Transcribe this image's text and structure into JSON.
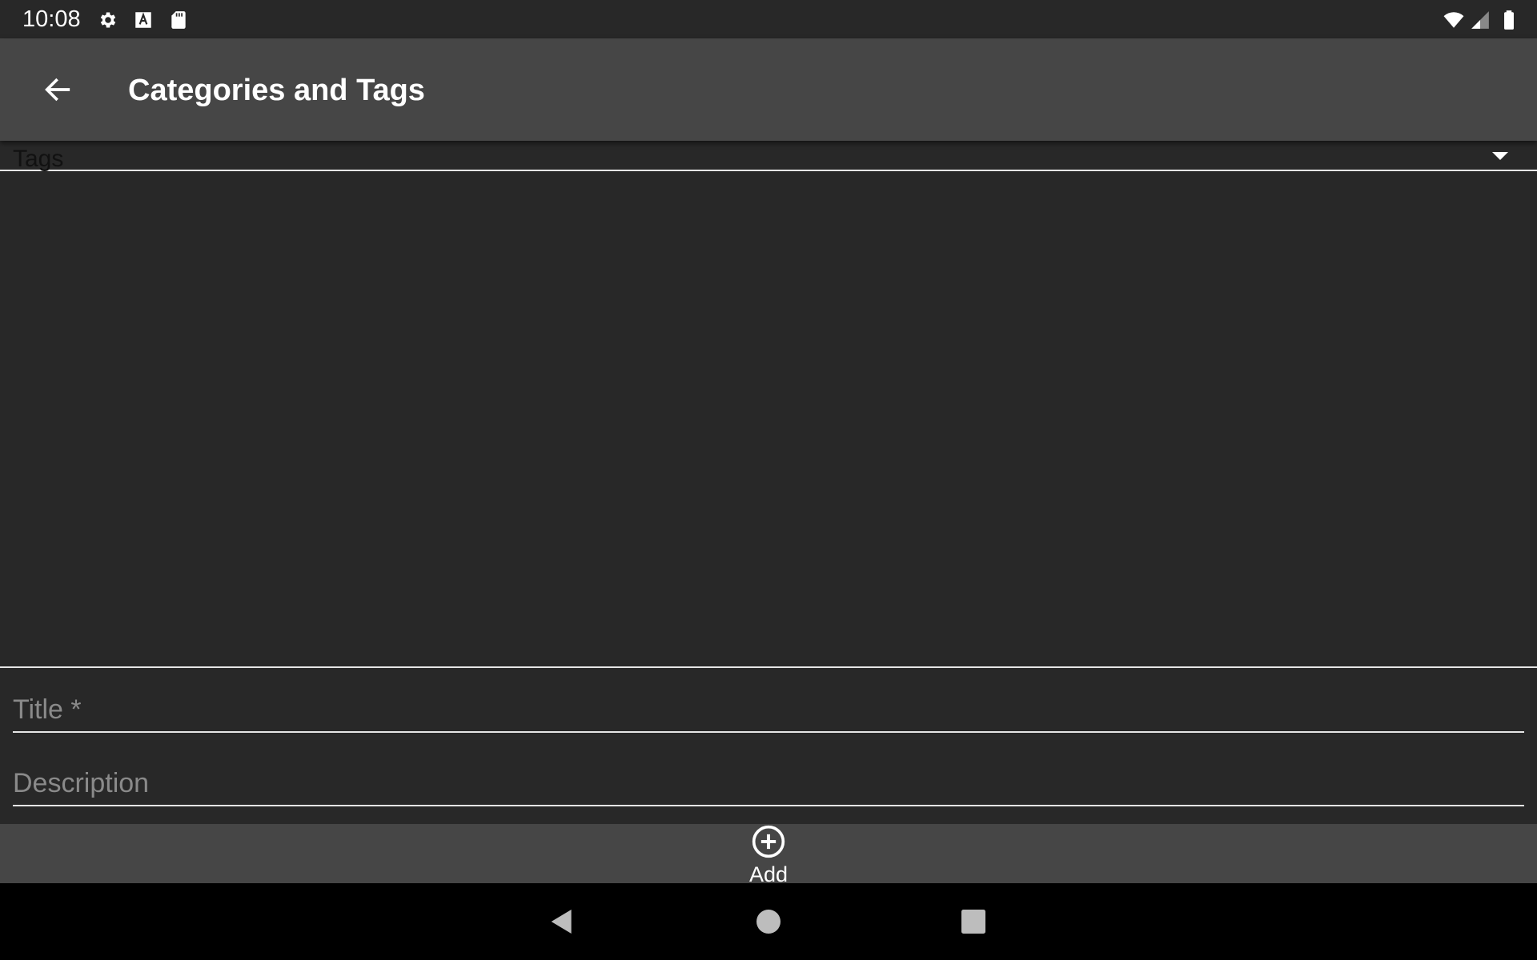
{
  "status_bar": {
    "time": "10:08",
    "icons": [
      "gear-icon",
      "font-a-icon",
      "sd-card-icon",
      "wifi-icon",
      "signal-icon",
      "battery-icon"
    ]
  },
  "app_bar": {
    "title": "Categories and Tags",
    "back_icon": "arrow-back-icon"
  },
  "tags_dropdown": {
    "selected": "Tags"
  },
  "form": {
    "title_placeholder": "Title *",
    "title_value": "",
    "description_placeholder": "Description",
    "description_value": ""
  },
  "add_button": {
    "label": "Add",
    "icon": "add-circle-icon"
  },
  "nav_bar": {
    "buttons": [
      "back-triangle-icon",
      "home-circle-icon",
      "recents-square-icon"
    ]
  },
  "colors": {
    "background": "#282828",
    "app_bar": "#464646",
    "nav_bar": "#000000",
    "text": "#ffffff",
    "placeholder": "#8a8a8a"
  }
}
